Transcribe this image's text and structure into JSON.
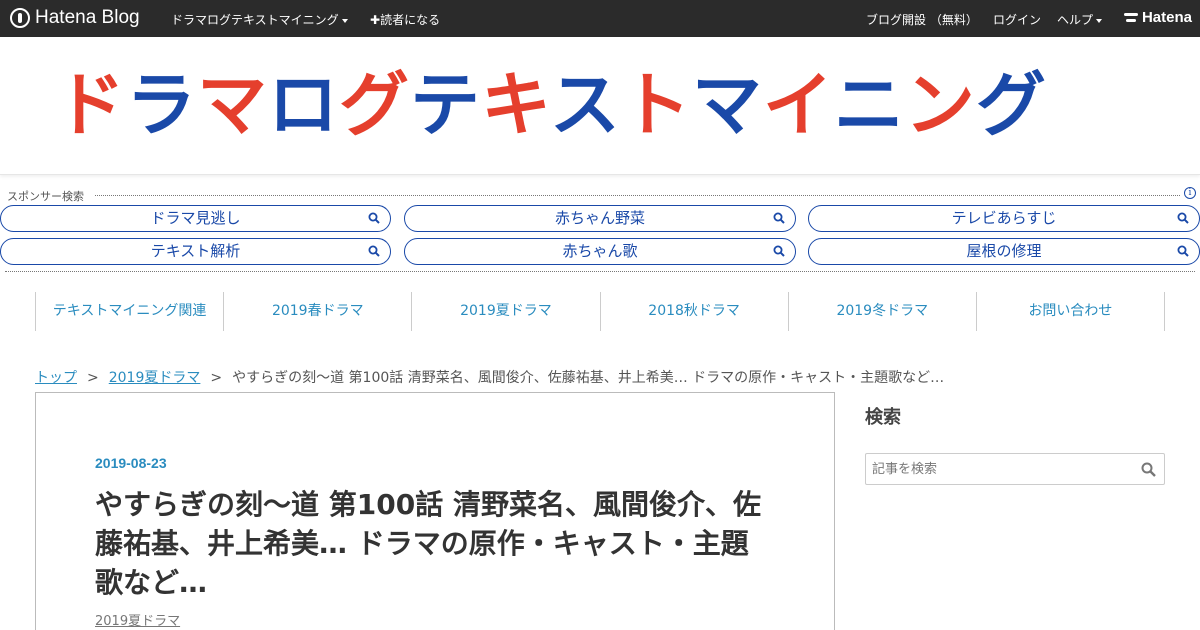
{
  "topbar": {
    "brand": "Hatena Blog",
    "blog_menu": "ドラマログテキストマイニング",
    "subscribe": "読者になる",
    "open_blog": "ブログ開設 （無料）",
    "login": "ログイン",
    "help": "ヘルプ",
    "hatena": "Hatena"
  },
  "header": {
    "logo_parts": [
      {
        "text": "ド",
        "color": "#e53f2d"
      },
      {
        "text": "ラ",
        "color": "#1a49a8"
      },
      {
        "text": "マ",
        "color": "#e53f2d"
      },
      {
        "text": "ロ",
        "color": "#1a49a8"
      },
      {
        "text": "グ",
        "color": "#e53f2d"
      },
      {
        "text": "テ",
        "color": "#1a49a8"
      },
      {
        "text": "キ",
        "color": "#e53f2d"
      },
      {
        "text": "ス",
        "color": "#1a49a8"
      },
      {
        "text": "ト",
        "color": "#e53f2d"
      },
      {
        "text": "マ",
        "color": "#1a49a8"
      },
      {
        "text": "イ",
        "color": "#e53f2d"
      },
      {
        "text": "ニ",
        "color": "#1a49a8"
      },
      {
        "text": "ン",
        "color": "#e53f2d"
      },
      {
        "text": "グ",
        "color": "#1a49a8"
      }
    ]
  },
  "sponsor": {
    "label": "スポンサー検索",
    "info": "i",
    "pills": [
      "ドラマ見逃し",
      "赤ちゃん野菜",
      "テレビあらすじ",
      "テキスト解析",
      "赤ちゃん歌",
      "屋根の修理"
    ]
  },
  "nav": {
    "items": [
      "テキストマイニング関連",
      "2019春ドラマ",
      "2019夏ドラマ",
      "2018秋ドラマ",
      "2019冬ドラマ",
      "お問い合わせ"
    ]
  },
  "breadcrumb": {
    "top": "トップ",
    "sep": ">",
    "category": "2019夏ドラマ",
    "current": "やすらぎの刻～道 第100話 清野菜名、風間俊介、佐藤祐基、井上希美… ドラマの原作・キャスト・主題歌など…"
  },
  "article": {
    "date": "2019-08-23",
    "title": "やすらぎの刻～道 第100話 清野菜名、風間俊介、佐藤祐基、井上希美… ドラマの原作・キャスト・主題歌など…",
    "category": "2019夏ドラマ"
  },
  "sidebar": {
    "search_title": "検索",
    "search_placeholder": "記事を検索"
  },
  "colors": {
    "accent": "#2a8cbf",
    "pill": "#1a49a8",
    "logo_red": "#e53f2d",
    "logo_blue": "#1a49a8"
  }
}
